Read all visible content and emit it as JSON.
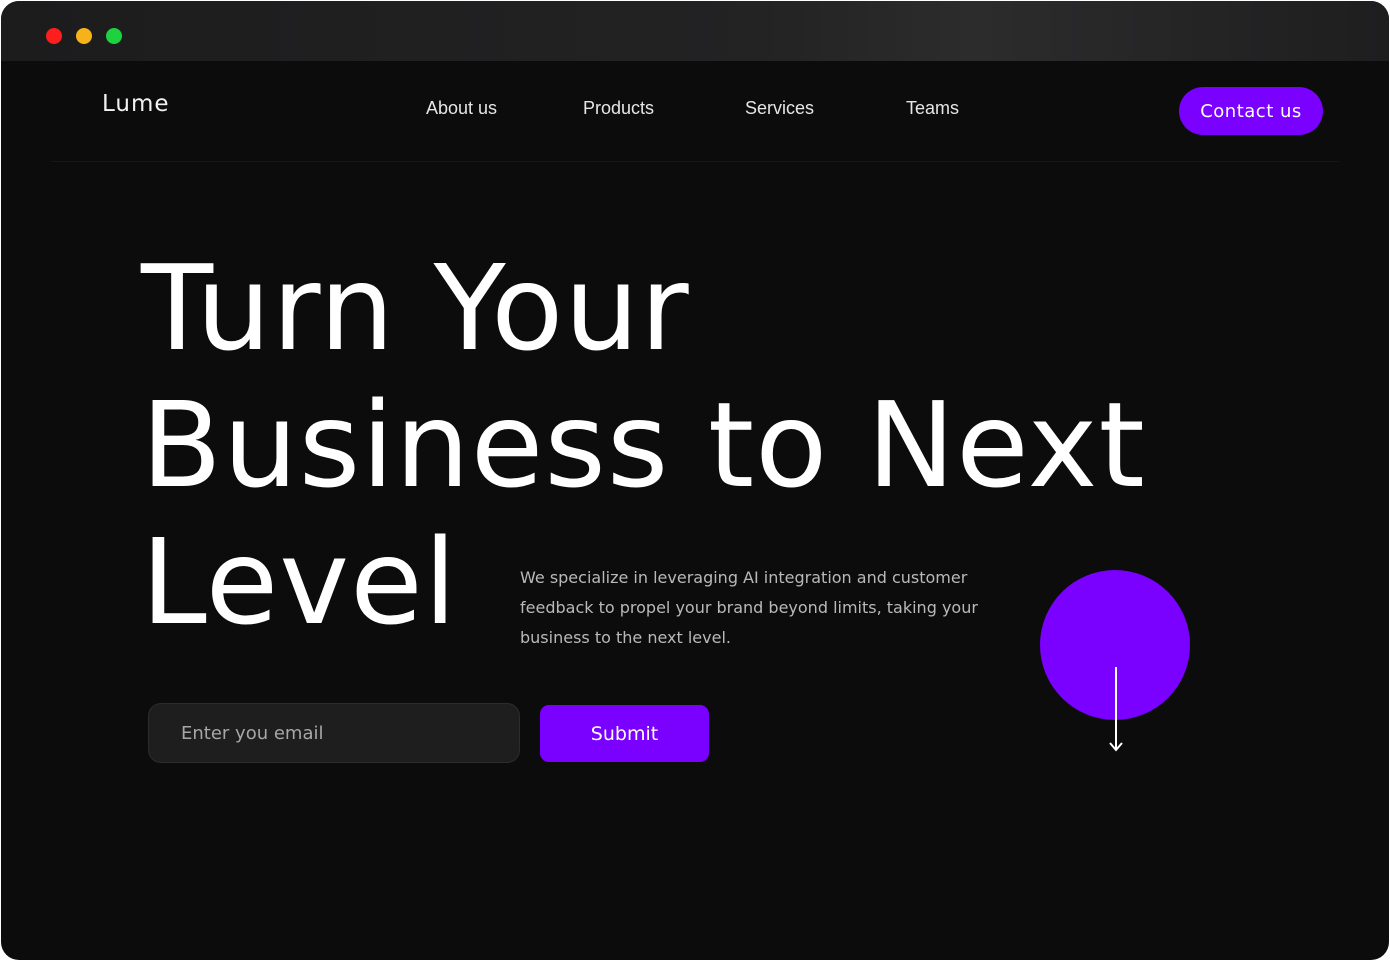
{
  "window": {
    "controls": [
      "close",
      "minimize",
      "maximize"
    ]
  },
  "header": {
    "logo": "Lume",
    "nav": [
      "About us",
      "Products",
      "Services",
      "Teams"
    ],
    "contact_label": "Contact us"
  },
  "hero": {
    "title_lines": [
      "Turn Your",
      "Business to Next",
      "Level"
    ],
    "description": "We specialize in leveraging AI integration and customer feedback to propel your brand beyond limits, taking your business to the next level.",
    "email_placeholder": "Enter you email",
    "submit_label": "Submit"
  },
  "colors": {
    "accent": "#7a00ff",
    "background": "#0c0c0d",
    "text": "#ffffff"
  },
  "icons": {
    "scroll": "arrow-down-icon"
  }
}
